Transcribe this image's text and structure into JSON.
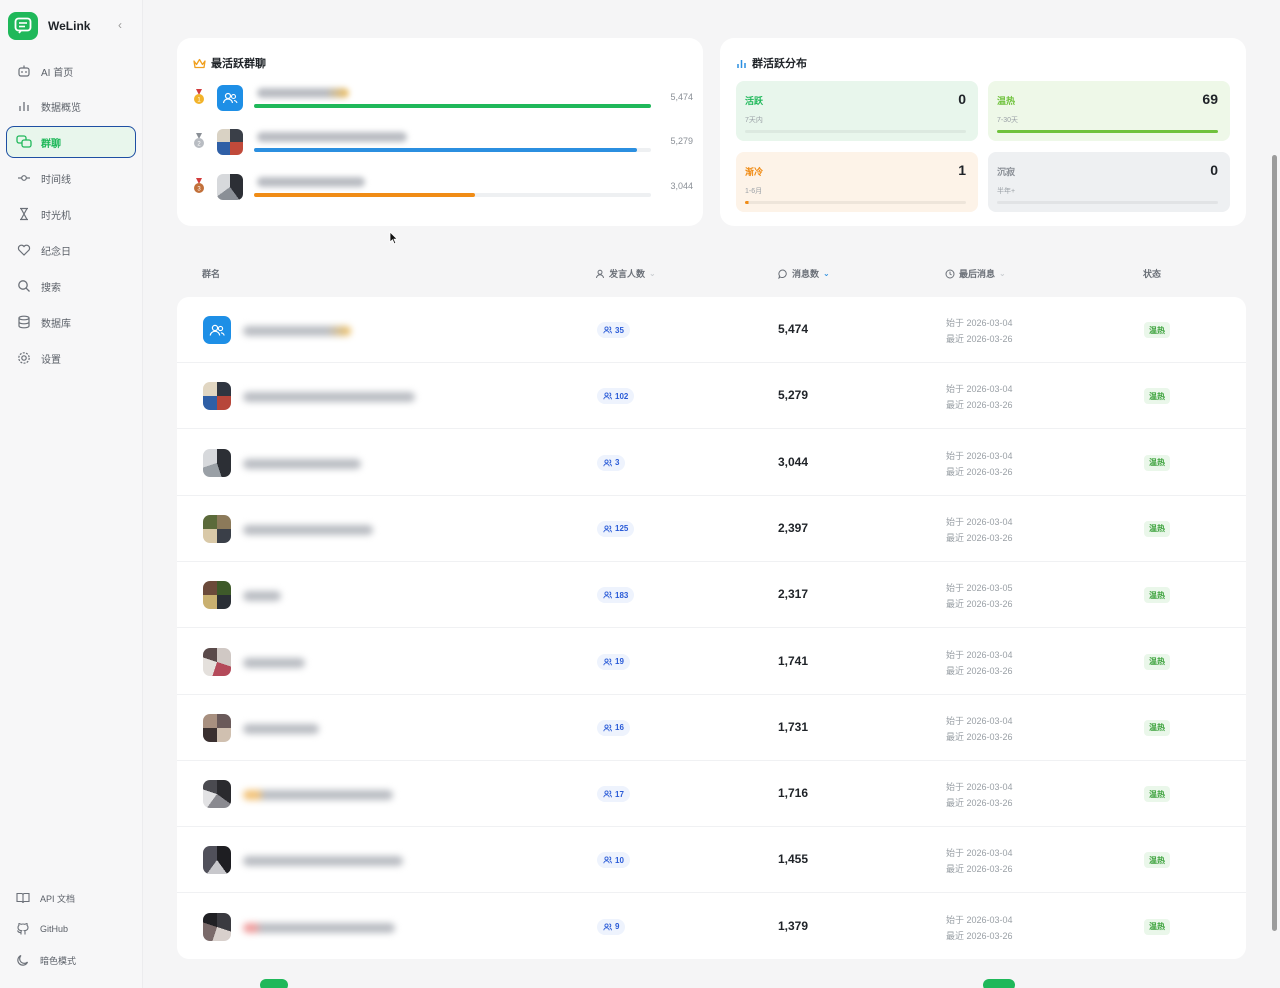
{
  "app": {
    "name": "WeLink",
    "accent": "#1fb85a"
  },
  "sidebar": {
    "items": [
      {
        "label": "AI 首页",
        "icon": "robot-icon"
      },
      {
        "label": "数据概览",
        "icon": "bar-chart-icon"
      },
      {
        "label": "群聊",
        "icon": "chat-bubbles-icon",
        "active": true
      },
      {
        "label": "时间线",
        "icon": "timeline-icon"
      },
      {
        "label": "时光机",
        "icon": "hourglass-icon"
      },
      {
        "label": "纪念日",
        "icon": "heart-icon"
      },
      {
        "label": "搜索",
        "icon": "search-icon"
      },
      {
        "label": "数据库",
        "icon": "database-icon"
      },
      {
        "label": "设置",
        "icon": "gear-icon"
      }
    ],
    "bottom": [
      {
        "label": "API 文档",
        "icon": "book-icon"
      },
      {
        "label": "GitHub",
        "icon": "github-icon"
      },
      {
        "label": "暗色模式",
        "icon": "moon-icon"
      }
    ]
  },
  "top_groups": {
    "title": "最活跃群聊",
    "items": [
      {
        "value": "5,474",
        "fraction": 1.0,
        "color": "#1fb85a"
      },
      {
        "value": "5,279",
        "fraction": 0.964,
        "color": "#2b8fe0"
      },
      {
        "value": "3,044",
        "fraction": 0.556,
        "color": "#f08c16"
      }
    ]
  },
  "distribution": {
    "title": "群活跃分布",
    "items": [
      {
        "label": "活跃",
        "sub": "7天内",
        "count": "0",
        "color": "#1fb85a",
        "bg": "#e8f6ec",
        "fraction": 0
      },
      {
        "label": "温热",
        "sub": "7-30天",
        "count": "69",
        "color": "#6fc23c",
        "bg": "#eef8e8",
        "fraction": 1.0
      },
      {
        "label": "渐冷",
        "sub": "1-6月",
        "count": "1",
        "color": "#f08c16",
        "bg": "#fdf3e8",
        "fraction": 0.014
      },
      {
        "label": "沉寂",
        "sub": "半年+",
        "count": "0",
        "color": "#8a8f96",
        "bg": "#eef0f2",
        "fraction": 0
      }
    ]
  },
  "table": {
    "headers": {
      "name": "群名",
      "speakers": "发言人数",
      "messages": "消息数",
      "last": "最后消息",
      "status": "状态"
    },
    "rows": [
      {
        "speakers": "35",
        "messages": "5,474",
        "start": "始于 2026-03-04",
        "recent": "最近 2026-03-26",
        "status": "温热"
      },
      {
        "speakers": "102",
        "messages": "5,279",
        "start": "始于 2026-03-04",
        "recent": "最近 2026-03-26",
        "status": "温热"
      },
      {
        "speakers": "3",
        "messages": "3,044",
        "start": "始于 2026-03-04",
        "recent": "最近 2026-03-26",
        "status": "温热"
      },
      {
        "speakers": "125",
        "messages": "2,397",
        "start": "始于 2026-03-04",
        "recent": "最近 2026-03-26",
        "status": "温热"
      },
      {
        "speakers": "183",
        "messages": "2,317",
        "start": "始于 2026-03-05",
        "recent": "最近 2026-03-26",
        "status": "温热"
      },
      {
        "speakers": "19",
        "messages": "1,741",
        "start": "始于 2026-03-04",
        "recent": "最近 2026-03-26",
        "status": "温热"
      },
      {
        "speakers": "16",
        "messages": "1,731",
        "start": "始于 2026-03-04",
        "recent": "最近 2026-03-26",
        "status": "温热"
      },
      {
        "speakers": "17",
        "messages": "1,716",
        "start": "始于 2026-03-04",
        "recent": "最近 2026-03-26",
        "status": "温热"
      },
      {
        "speakers": "10",
        "messages": "1,455",
        "start": "始于 2026-03-04",
        "recent": "最近 2026-03-26",
        "status": "温热"
      },
      {
        "speakers": "9",
        "messages": "1,379",
        "start": "始于 2026-03-04",
        "recent": "最近 2026-03-26",
        "status": "温热"
      }
    ]
  }
}
